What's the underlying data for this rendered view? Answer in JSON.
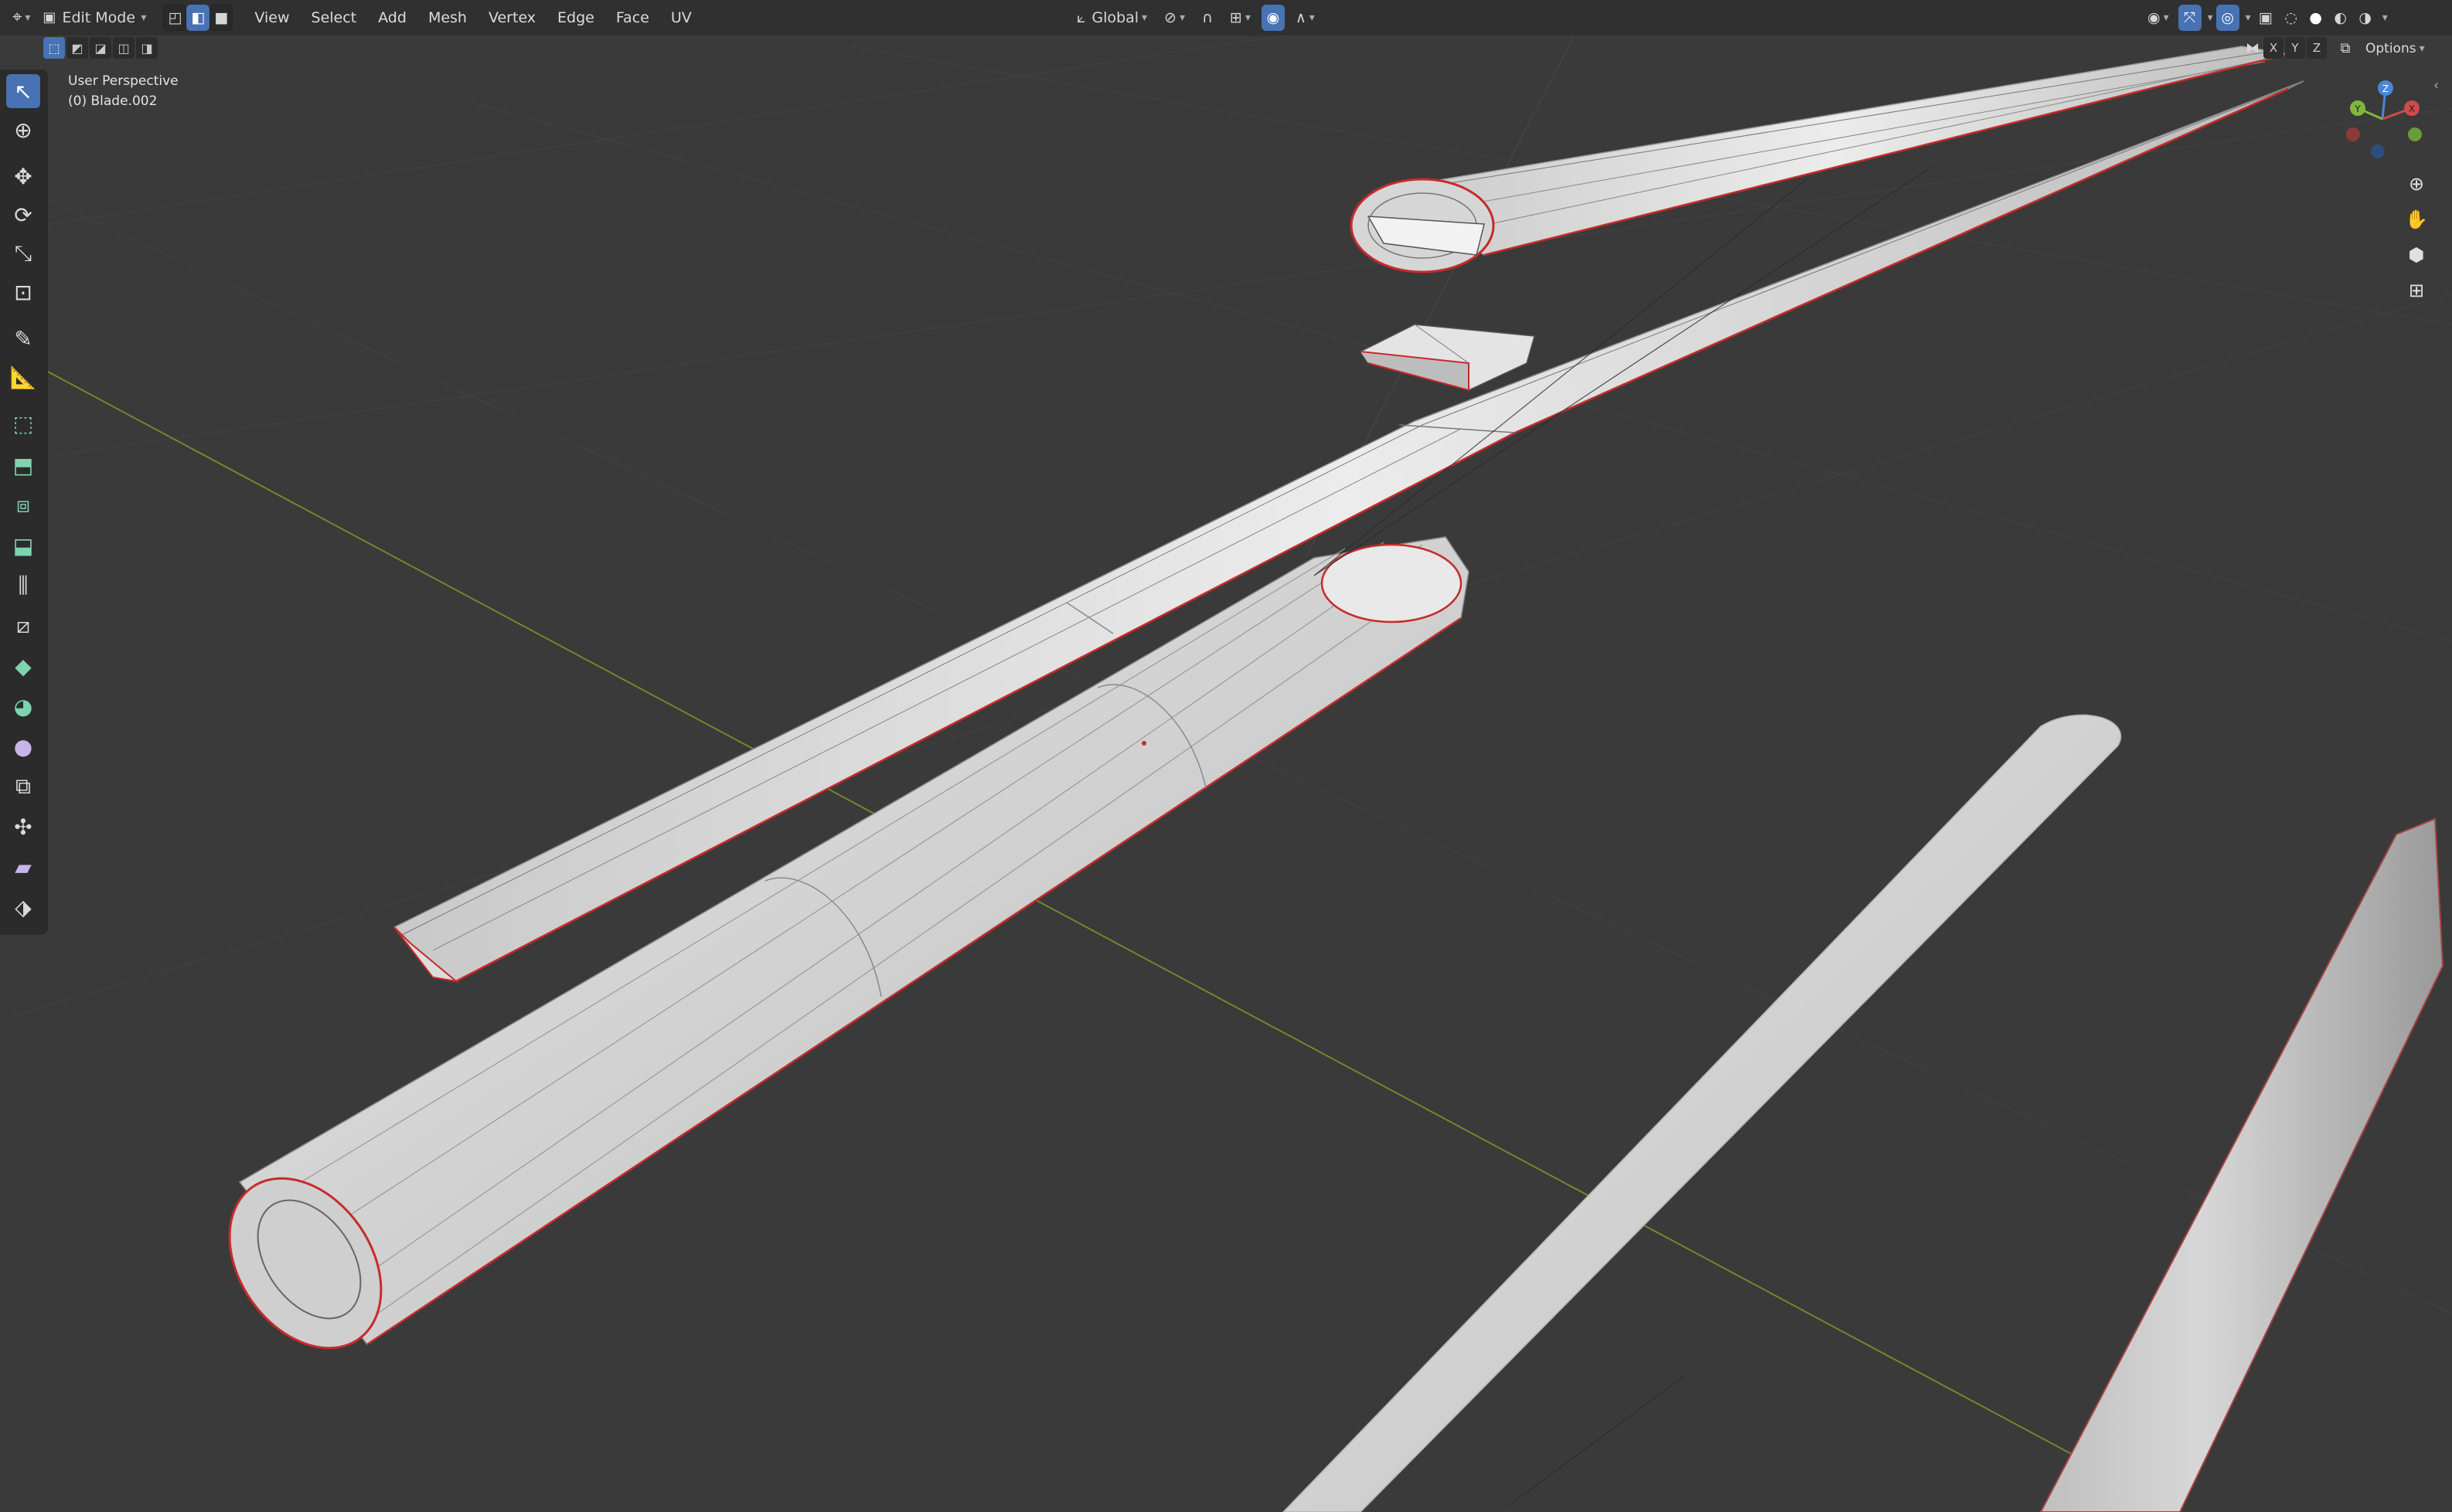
{
  "header": {
    "editor_type_icon": "editor-type-icon",
    "mode_label": "Edit Mode",
    "select_mode_icons": [
      "vertex-select-icon",
      "edge-select-icon",
      "face-select-icon"
    ],
    "menus": [
      "View",
      "Select",
      "Add",
      "Mesh",
      "Vertex",
      "Edge",
      "Face",
      "UV"
    ],
    "transform_orientation": "Global",
    "snap_icon": "magnet-icon",
    "proportional_icon": "proportional-edit-icon",
    "overlay_icons": [
      "visibility-icon",
      "gizmo-icon",
      "overlay-icon",
      "xray-icon"
    ],
    "shading_icons": [
      "wireframe-shading-icon",
      "solid-shading-icon",
      "material-shading-icon",
      "rendered-shading-icon"
    ],
    "accent_color": "#4772b3"
  },
  "subbar": {
    "select_box_modes": [
      "set-new-selection-icon",
      "extend-selection-icon",
      "subtract-selection-icon",
      "invert-selection-icon",
      "intersect-selection-icon"
    ]
  },
  "viewport_info": {
    "perspective": "User Perspective",
    "object": "(0) Blade.002"
  },
  "toolbar": {
    "tools": [
      "select-box-icon",
      "cursor-icon",
      "move-icon",
      "rotate-icon",
      "scale-icon",
      "transform-icon",
      "annotate-icon",
      "measure-icon",
      "add-cube-icon",
      "extrude-icon",
      "inset-icon",
      "bevel-icon",
      "loop-cut-icon",
      "knife-icon",
      "poly-build-icon",
      "spin-icon",
      "smooth-icon",
      "edge-slide-icon",
      "shrink-fatten-icon",
      "shear-icon",
      "rip-icon"
    ]
  },
  "right_controls": {
    "mirror_axes": [
      "X",
      "Y",
      "Z"
    ],
    "options_label": "Options",
    "gizmo_axes": [
      "Z",
      "Y",
      "X"
    ],
    "nav_icons": [
      "zoom-icon",
      "pan-hand-icon",
      "camera-icon",
      "ortho-grid-icon"
    ]
  },
  "scene": {
    "background_color": "#3a3a3a",
    "grid_color": "#444444",
    "x_axis_color": "#8a3a3a",
    "y_axis_color": "#6f8a2a",
    "mesh_color": "#d8d8d8",
    "selection_outline_color": "#d02a2a"
  }
}
